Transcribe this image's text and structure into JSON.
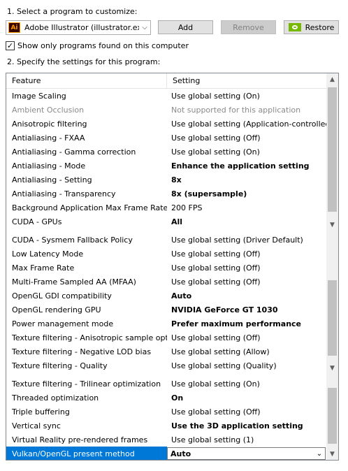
{
  "step1_label": "1. Select a program to customize:",
  "program": {
    "value": "Adobe Illustrator (illustrator.exe)",
    "icon": "Ai"
  },
  "buttons": {
    "add": "Add",
    "remove": "Remove",
    "restore": "Restore"
  },
  "show_only_label": "Show only programs found on this computer",
  "show_only_checked": "✓",
  "step2_label": "2. Specify the settings for this program:",
  "columns": {
    "feature": "Feature",
    "setting": "Setting"
  },
  "rows": [
    {
      "feature": "Image Scaling",
      "setting": "Use global setting (On)"
    },
    {
      "feature": "Ambient Occlusion",
      "setting": "Not supported for this application",
      "state": "dim"
    },
    {
      "feature": "Anisotropic filtering",
      "setting": "Use global setting (Application-controlled)"
    },
    {
      "feature": "Antialiasing - FXAA",
      "setting": "Use global setting (Off)"
    },
    {
      "feature": "Antialiasing - Gamma correction",
      "setting": "Use global setting (On)"
    },
    {
      "feature": "Antialiasing - Mode",
      "setting": "Enhance the application setting",
      "state": "bold"
    },
    {
      "feature": "Antialiasing - Setting",
      "setting": "8x",
      "state": "bold"
    },
    {
      "feature": "Antialiasing - Transparency",
      "setting": "8x (supersample)",
      "state": "bold"
    },
    {
      "feature": "Background Application Max Frame Rate",
      "setting": "200 FPS"
    },
    {
      "feature": "CUDA - GPUs",
      "setting": "All",
      "state": "bold"
    },
    {
      "feature": "CUDA - Sysmem Fallback Policy",
      "setting": "Use global setting (Driver Default)"
    },
    {
      "feature": "Low Latency Mode",
      "setting": "Use global setting (Off)"
    },
    {
      "feature": "Max Frame Rate",
      "setting": "Use global setting (Off)"
    },
    {
      "feature": "Multi-Frame Sampled AA (MFAA)",
      "setting": "Use global setting (Off)"
    },
    {
      "feature": "OpenGL GDI compatibility",
      "setting": "Auto",
      "state": "bold"
    },
    {
      "feature": "OpenGL rendering GPU",
      "setting": "NVIDIA GeForce GT 1030",
      "state": "bold"
    },
    {
      "feature": "Power management mode",
      "setting": "Prefer maximum performance",
      "state": "bold"
    },
    {
      "feature": "Texture filtering - Anisotropic sample opti...",
      "setting": "Use global setting (Off)"
    },
    {
      "feature": "Texture filtering - Negative LOD bias",
      "setting": "Use global setting (Allow)"
    },
    {
      "feature": "Texture filtering - Quality",
      "setting": "Use global setting (Quality)"
    },
    {
      "feature": "Texture filtering - Trilinear optimization",
      "setting": "Use global setting (On)"
    },
    {
      "feature": "Threaded optimization",
      "setting": "On",
      "state": "bold"
    },
    {
      "feature": "Triple buffering",
      "setting": "Use global setting (Off)"
    },
    {
      "feature": "Vertical sync",
      "setting": "Use the 3D application setting",
      "state": "bold"
    },
    {
      "feature": "Virtual Reality pre-rendered frames",
      "setting": "Use global setting (1)"
    },
    {
      "feature": "Vulkan/OpenGL present method",
      "setting": "Auto",
      "state": "sel"
    }
  ],
  "colors": {
    "selection": "#0078d7",
    "nvidia_green": "#76b900"
  }
}
